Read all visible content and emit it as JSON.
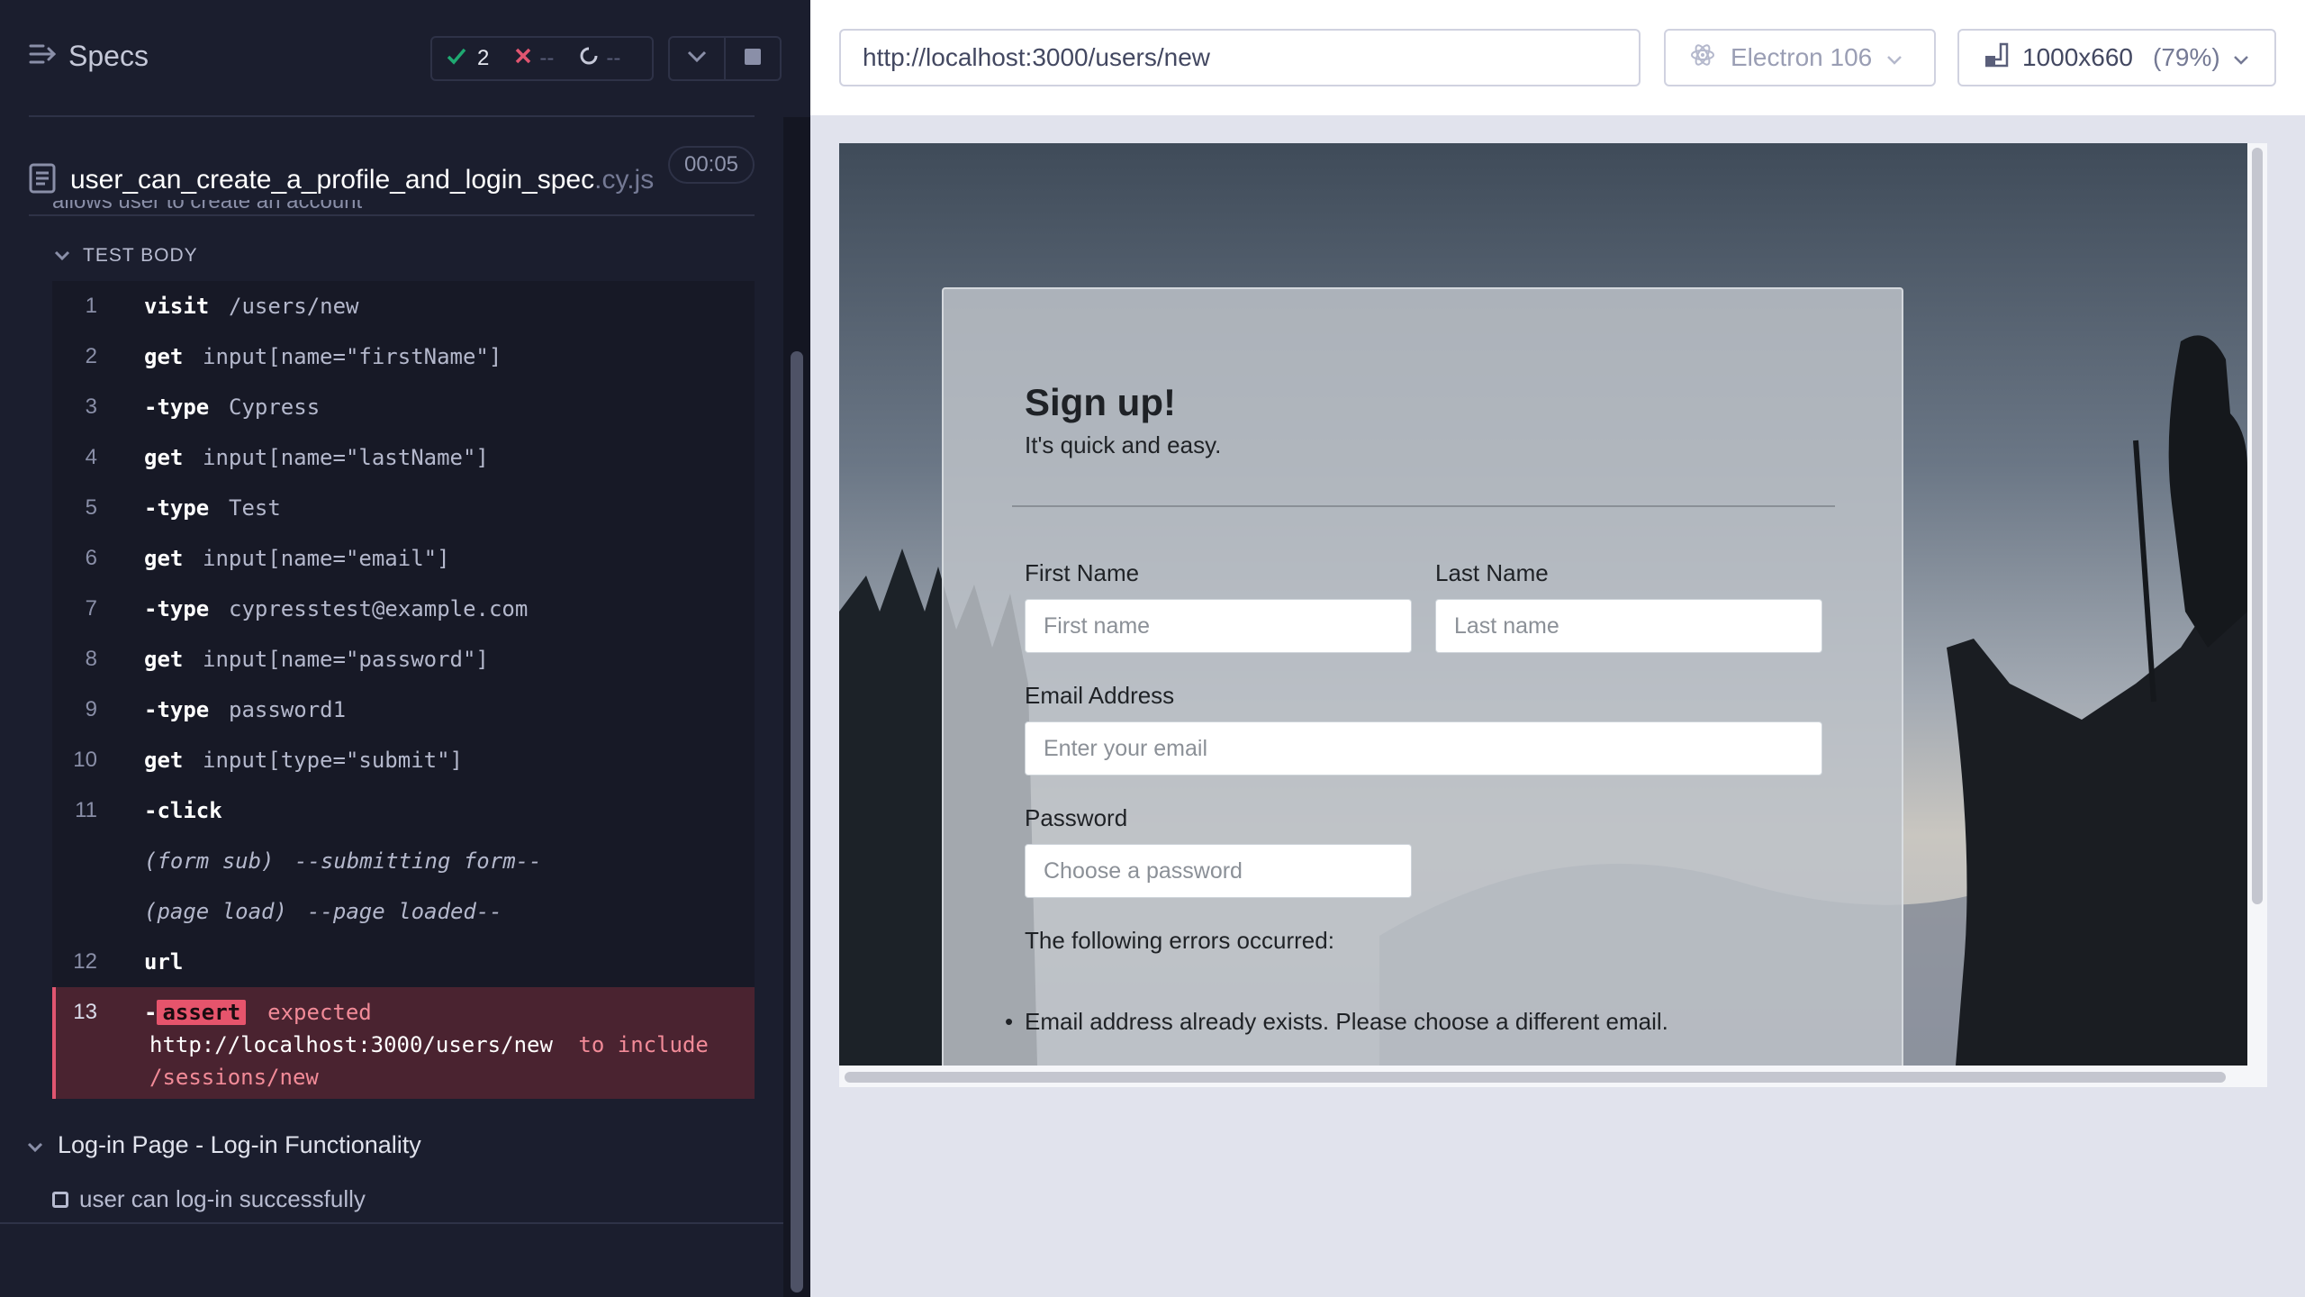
{
  "reporter": {
    "title": "Specs",
    "stats": {
      "passed": "2",
      "failed": "--",
      "pending": "--"
    },
    "spec": {
      "name": "user_can_create_a_profile_and_login_spec",
      "ext": ".cy.js",
      "duration": "00:05"
    },
    "cut_off_test": "allows user to create an account",
    "test_body_label": "TEST BODY",
    "commands": [
      {
        "num": "1",
        "name": "visit",
        "msg": "/users/new",
        "child": false
      },
      {
        "num": "2",
        "name": "get",
        "msg": "input[name=\"firstName\"]",
        "child": false
      },
      {
        "num": "3",
        "name": "-type",
        "msg": "Cypress",
        "child": true
      },
      {
        "num": "4",
        "name": "get",
        "msg": "input[name=\"lastName\"]",
        "child": false
      },
      {
        "num": "5",
        "name": "-type",
        "msg": "Test",
        "child": true
      },
      {
        "num": "6",
        "name": "get",
        "msg": "input[name=\"email\"]",
        "child": false
      },
      {
        "num": "7",
        "name": "-type",
        "msg": "cypresstest@example.com",
        "child": true
      },
      {
        "num": "8",
        "name": "get",
        "msg": "input[name=\"password\"]",
        "child": false
      },
      {
        "num": "9",
        "name": "-type",
        "msg": "password1",
        "child": true
      },
      {
        "num": "10",
        "name": "get",
        "msg": "input[type=\"submit\"]",
        "child": false
      },
      {
        "num": "11",
        "name": "-click",
        "msg": "",
        "child": true
      }
    ],
    "events": [
      {
        "name": "(form sub)",
        "msg": "--submitting form--"
      },
      {
        "name": "(page load)",
        "msg": "--page loaded--"
      }
    ],
    "url_cmd": {
      "num": "12",
      "name": "url"
    },
    "assert_cmd": {
      "num": "13",
      "dash": "-",
      "badge": "assert",
      "expected": "expected",
      "actual_url": "http://localhost:3000/users/new",
      "to_include": "to include",
      "target": "/sessions/new"
    },
    "suite": "Log-in Page - Log-in Functionality",
    "pending_test": "user can log-in successfully"
  },
  "aut": {
    "url": "http://localhost:3000/users/new",
    "browser": "Electron 106",
    "viewport": "1000x660",
    "scale": "(79%)"
  },
  "signup": {
    "title": "Sign up!",
    "subtitle": "It's quick and easy.",
    "first_name_label": "First Name",
    "first_name_placeholder": "First name",
    "last_name_label": "Last Name",
    "last_name_placeholder": "Last name",
    "email_label": "Email Address",
    "email_placeholder": "Enter your email",
    "password_label": "Password",
    "password_placeholder": "Choose a password",
    "errors_title": "The following errors occurred:",
    "errors": [
      "Email address already exists. Please choose a different email."
    ]
  },
  "colors": {
    "reporter_bg": "#1b1e2e",
    "pass": "#1fa971",
    "fail": "#e05570",
    "aut_bg": "#e1e3ed"
  }
}
